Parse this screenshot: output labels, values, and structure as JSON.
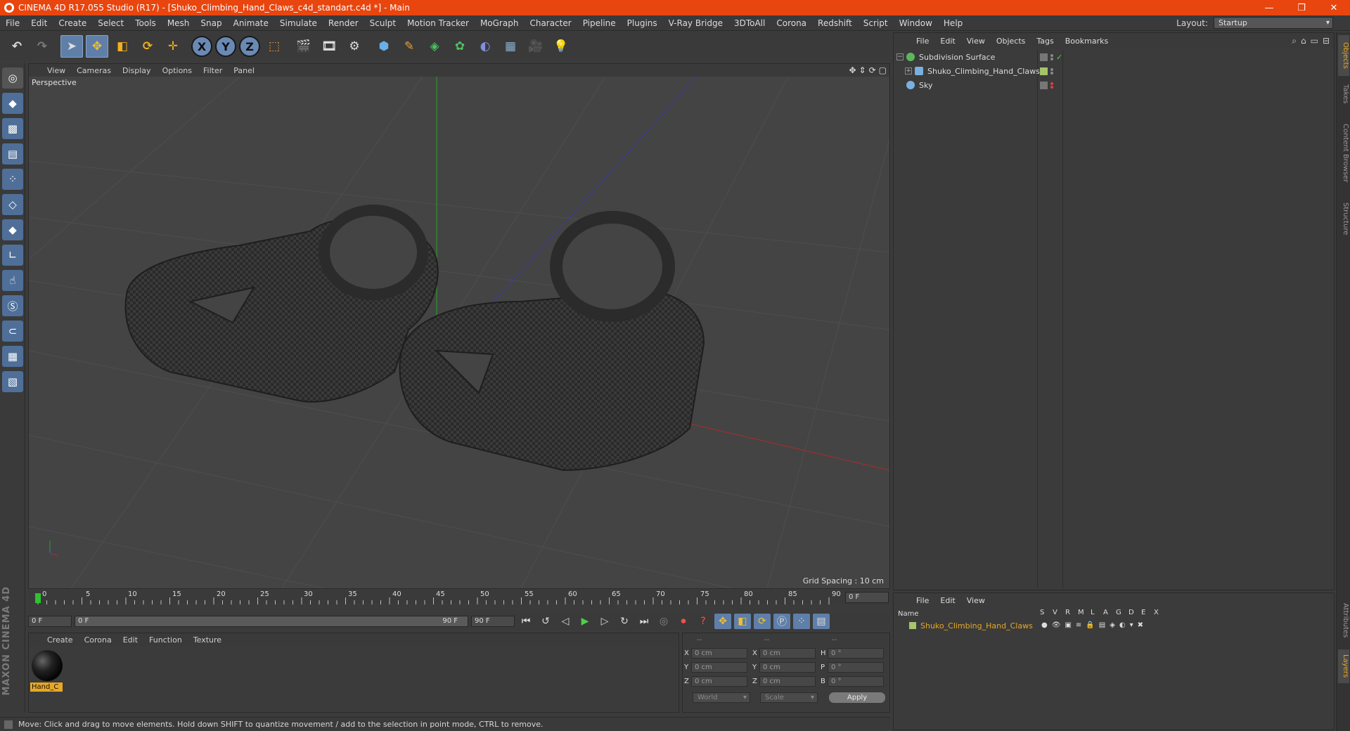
{
  "window": {
    "title": "CINEMA 4D R17.055 Studio (R17) - [Shuko_Climbing_Hand_Claws_c4d_standart.c4d *] - Main",
    "controls": [
      "—",
      "❐",
      "✕"
    ]
  },
  "menu": {
    "items": [
      "File",
      "Edit",
      "Create",
      "Select",
      "Tools",
      "Mesh",
      "Snap",
      "Animate",
      "Simulate",
      "Render",
      "Sculpt",
      "Motion Tracker",
      "MoGraph",
      "Character",
      "Pipeline",
      "Plugins",
      "V-Ray Bridge",
      "3DToAll",
      "Corona",
      "Redshift",
      "Script",
      "Window",
      "Help"
    ],
    "layout_label": "Layout:",
    "layout_value": "Startup"
  },
  "toolbar": {
    "x_label": "X",
    "y_label": "Y",
    "z_label": "Z"
  },
  "viewport": {
    "menu": [
      "View",
      "Cameras",
      "Display",
      "Options",
      "Filter",
      "Panel"
    ],
    "label": "Perspective",
    "grid_spacing": "Grid Spacing : 10 cm",
    "colors": {
      "background": "#444444",
      "grid": "#4f4f4f",
      "x_axis": "#b02a2a",
      "y_axis": "#2aa02a",
      "z_axis": "#3a3aa0",
      "model": "#2b2b2b"
    }
  },
  "timeline": {
    "ticks": [
      "0",
      "5",
      "10",
      "15",
      "20",
      "25",
      "30",
      "35",
      "40",
      "45",
      "50",
      "55",
      "60",
      "65",
      "70",
      "75",
      "80",
      "85",
      "90"
    ],
    "current_frame": "0 F",
    "start_field": "0 F",
    "range_start": "0 F",
    "range_end": "90 F",
    "end_field": "90 F"
  },
  "material_manager": {
    "menu": [
      "Create",
      "Corona",
      "Edit",
      "Function",
      "Texture"
    ],
    "materials": [
      {
        "name": "Hand_C"
      }
    ]
  },
  "coordinates": {
    "headers": [
      "--",
      "--",
      "--"
    ],
    "rows": [
      {
        "a": "X",
        "av": "0 cm",
        "b": "X",
        "bv": "0 cm",
        "c": "H",
        "cv": "0 °"
      },
      {
        "a": "Y",
        "av": "0 cm",
        "b": "Y",
        "bv": "0 cm",
        "c": "P",
        "cv": "0 °"
      },
      {
        "a": "Z",
        "av": "0 cm",
        "b": "Z",
        "bv": "0 cm",
        "c": "B",
        "cv": "0 °"
      }
    ],
    "mode_world": "World",
    "mode_scale": "Scale",
    "apply": "Apply"
  },
  "status": {
    "text": "Move: Click and drag to move elements. Hold down SHIFT to quantize movement / add to the selection in point mode, CTRL to remove."
  },
  "object_manager": {
    "menu": [
      "File",
      "Edit",
      "View",
      "Objects",
      "Tags",
      "Bookmarks"
    ],
    "objects": [
      {
        "name": "Subdivision Surface",
        "depth": 0,
        "icon_color": "#5ab85a"
      },
      {
        "name": "Shuko_Climbing_Hand_Claws",
        "depth": 1,
        "icon_color": "#7ab0e0"
      },
      {
        "name": "Sky",
        "depth": 0,
        "icon_color": "#7ab0e0"
      }
    ]
  },
  "layer_manager": {
    "menu": [
      "File",
      "Edit",
      "View"
    ],
    "columns": [
      "Name",
      "S",
      "V",
      "R",
      "M",
      "L",
      "A",
      "G",
      "D",
      "E",
      "X"
    ],
    "layers": [
      {
        "name": "Shuko_Climbing_Hand_Claws",
        "color": "#a6c46a"
      }
    ]
  },
  "side_tabs": [
    "Objects",
    "Takes",
    "Content Browser",
    "Structure",
    "Attributes",
    "Layers"
  ]
}
